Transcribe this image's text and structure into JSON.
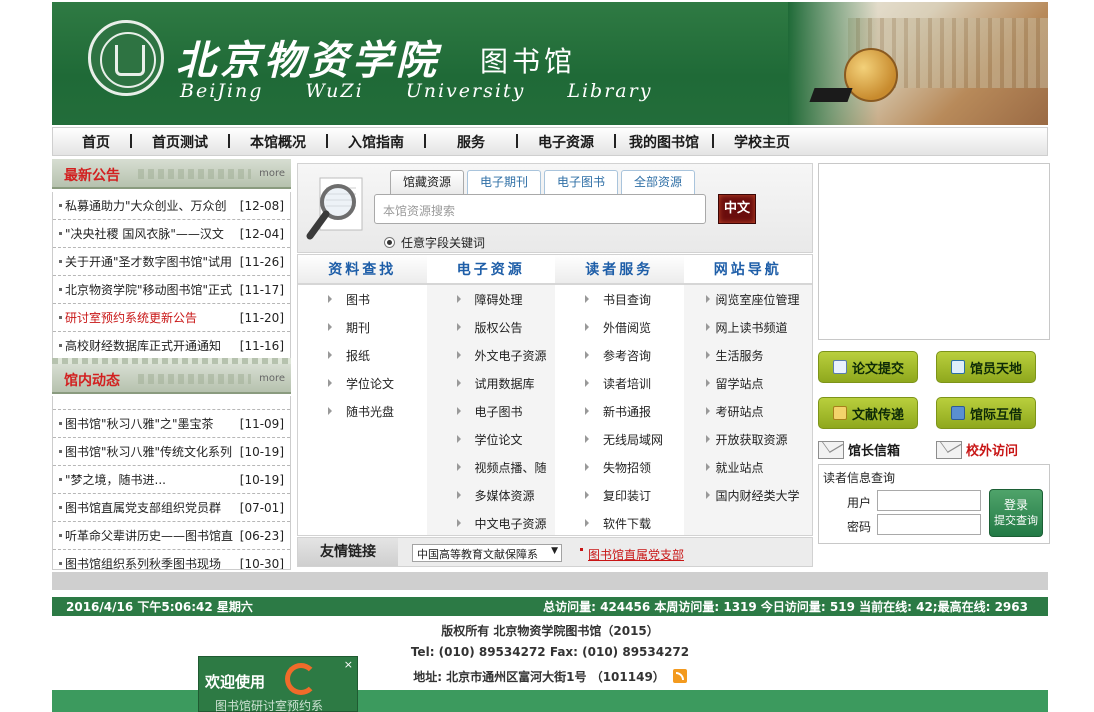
{
  "header": {
    "cn_name": "北京物资学院",
    "cn_lib": "图书馆",
    "en_name": "BeiJing WuZi University Library"
  },
  "nav": [
    "首页",
    "首页测试",
    "本馆概况",
    "入馆指南",
    "服务",
    "电子资源",
    "我的图书馆",
    "学校主页"
  ],
  "announcements": {
    "title": "最新公告",
    "more": "more",
    "items": [
      {
        "text": "私募通助力\"大众创业、万众创",
        "date": "[12-08]",
        "red": false
      },
      {
        "text": "\"决央社稷 国风衣脉\"——汉文",
        "date": "[12-04]",
        "red": false
      },
      {
        "text": "关于开通\"圣才数字图书馆\"试用",
        "date": "[11-26]",
        "red": false
      },
      {
        "text": "北京物资学院\"移动图书馆\"正式",
        "date": "[11-17]",
        "red": false
      },
      {
        "text": "研讨室预约系统更新公告",
        "date": "[11-20]",
        "red": true
      },
      {
        "text": "高校财经数据库正式开通通知",
        "date": "[11-16]",
        "red": false
      }
    ]
  },
  "news": {
    "title": "馆内动态",
    "more": "more",
    "items": [
      {
        "text": "图书馆\"秋习八雅\"之\"墨宝茶",
        "date": "[11-09]"
      },
      {
        "text": "图书馆\"秋习八雅\"传统文化系列",
        "date": "[10-19]"
      },
      {
        "text": "\"梦之境，随书进...",
        "date": "[10-19]"
      },
      {
        "text": "图书馆直属党支部组织党员群",
        "date": "[07-01]"
      },
      {
        "text": "听革命父辈讲历史——图书馆直",
        "date": "[06-23]"
      },
      {
        "text": "图书馆组织系列秋季图书现场",
        "date": "[10-30]"
      }
    ]
  },
  "search": {
    "tabs": [
      "馆藏资源",
      "电子期刊",
      "电子图书",
      "全部资源"
    ],
    "placeholder": "本馆资源搜索",
    "button": "中文",
    "radio_label": "任意字段关键词"
  },
  "columns": [
    {
      "title": "资料查找",
      "items": [
        "图书",
        "期刊",
        "报纸",
        "学位论文",
        "随书光盘"
      ]
    },
    {
      "title": "电子资源",
      "items": [
        "障碍处理",
        "版权公告",
        "外文电子资源",
        "试用数据库",
        "电子图书",
        "学位论文",
        "视频点播、随",
        "多媒体资源",
        "中文电子资源"
      ]
    },
    {
      "title": "读者服务",
      "items": [
        "书目查询",
        "外借阅览",
        "参考咨询",
        "读者培训",
        "新书通报",
        "无线局域网",
        "失物招领",
        "复印装订",
        "软件下载"
      ]
    },
    {
      "title": "网站导航",
      "items": [
        "阅览室座位管理",
        "网上读书频道",
        "生活服务",
        "留学站点",
        "考研站点",
        "开放获取资源",
        "就业站点",
        "国内财经类大学"
      ]
    }
  ],
  "links": {
    "label": "友情链接",
    "select": "中国高等教育文献保障系",
    "link": "图书馆直属党支部"
  },
  "right_buttons": [
    "论文提交",
    "馆员天地",
    "文献传递",
    "馆际互借"
  ],
  "mail": {
    "left": "馆长信箱",
    "right": "校外访问"
  },
  "reader": {
    "title": "读者信息查询",
    "user_label": "用户",
    "pass_label": "密码",
    "login": "登录",
    "submit": "提交查询"
  },
  "status": {
    "time": "2016/4/16 下午5:06:42 星期六",
    "stats": "总访问量: 424456 本周访问量: 1319 今日访问量: 519 当前在线: 42;最高在线: 2963"
  },
  "footer": {
    "copyright": "版权所有 北京物资学院图书馆（2015）",
    "tel": "Tel: (010) 89534272 Fax: (010) 89534272",
    "addr": "地址: 北京市通州区富河大街1号 （101149）"
  },
  "welcome": {
    "title": "欢迎使用",
    "close": "×",
    "sub": "图书馆研讨室预约系"
  },
  "colors": {
    "brand_green": "#2c7a45",
    "accent_red": "#c81515",
    "link_blue": "#1e5ea8",
    "button_olive": "#9fb82a"
  }
}
